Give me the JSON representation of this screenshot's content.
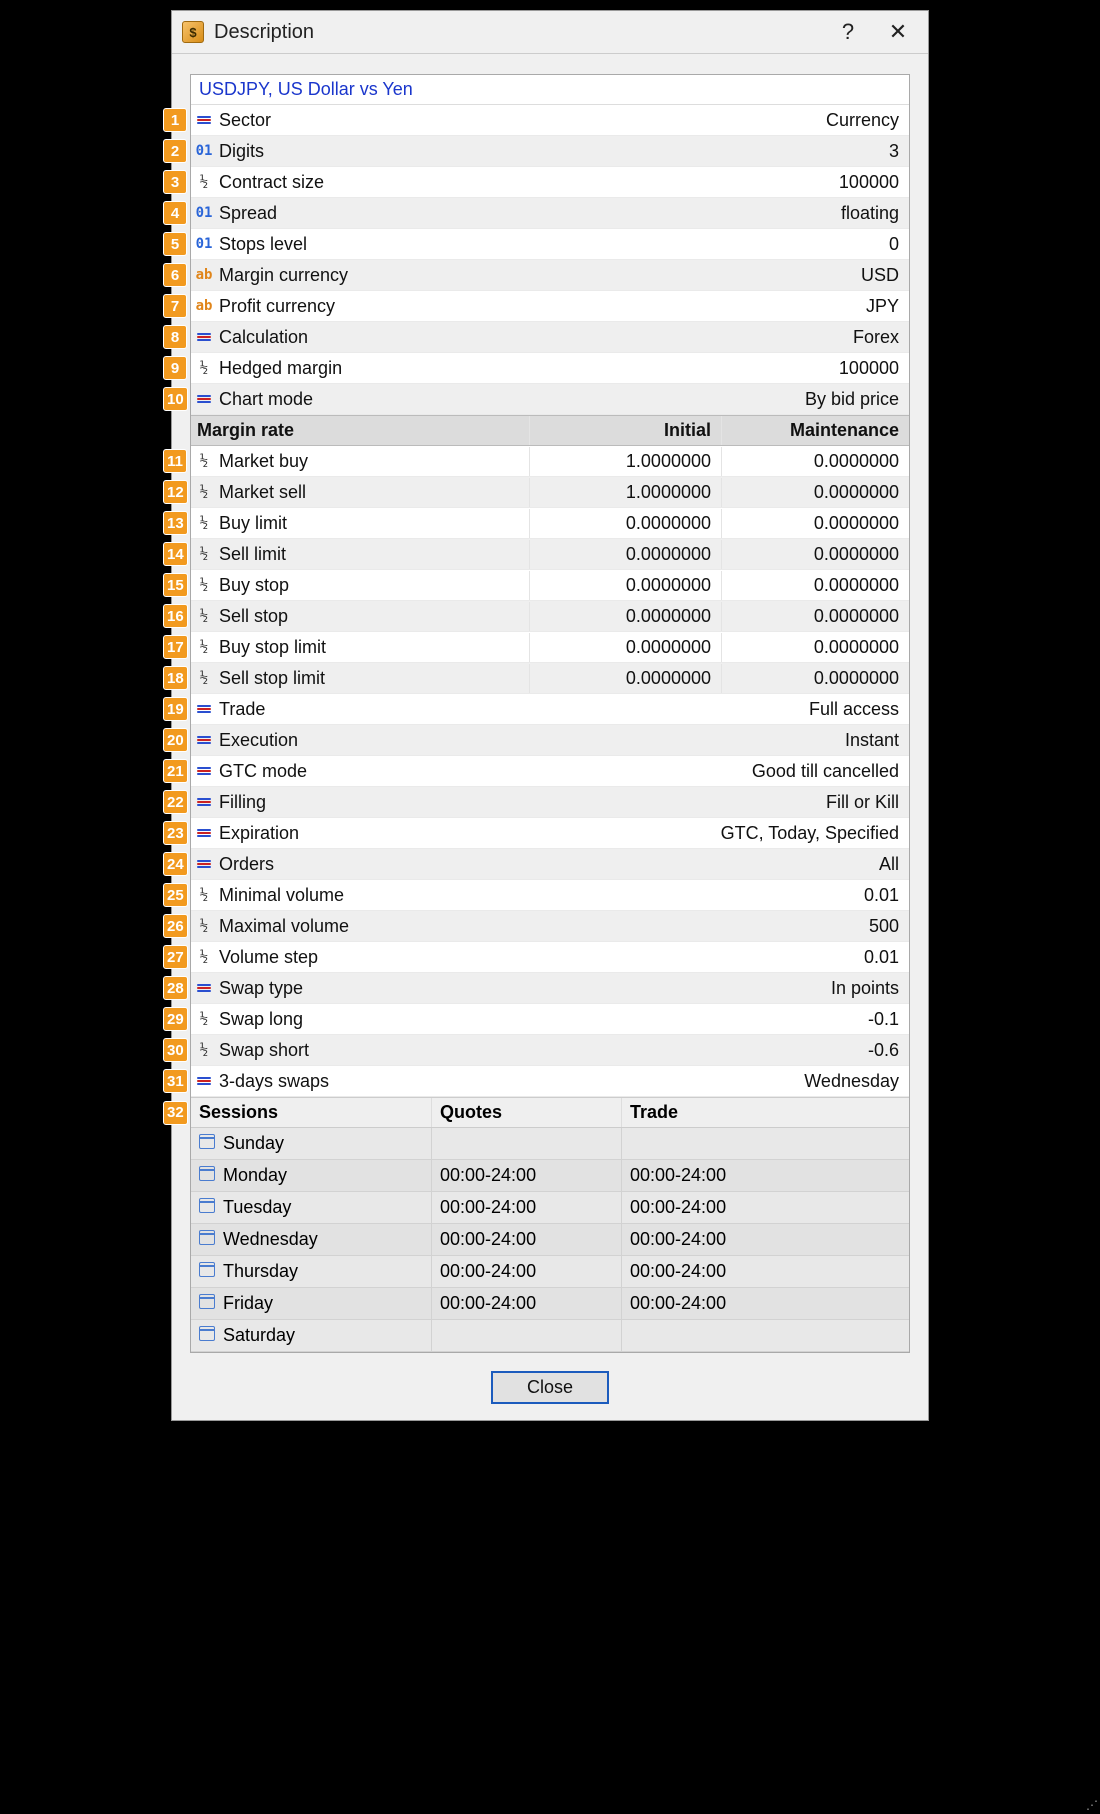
{
  "dialog": {
    "title": "Description",
    "help": "?",
    "close_symbol": "✕",
    "close_button": "Close",
    "app_icon_glyph": "$"
  },
  "symbol_header": "USDJPY, US Dollar vs Yen",
  "props": [
    {
      "n": "1",
      "icon": "enum",
      "label": "Sector",
      "value": "Currency"
    },
    {
      "n": "2",
      "icon": "01",
      "label": "Digits",
      "value": "3"
    },
    {
      "n": "3",
      "icon": "half",
      "label": "Contract size",
      "value": "100000"
    },
    {
      "n": "4",
      "icon": "01",
      "label": "Spread",
      "value": "floating"
    },
    {
      "n": "5",
      "icon": "01",
      "label": "Stops level",
      "value": "0"
    },
    {
      "n": "6",
      "icon": "ab",
      "label": "Margin currency",
      "value": "USD"
    },
    {
      "n": "7",
      "icon": "ab",
      "label": "Profit currency",
      "value": "JPY"
    },
    {
      "n": "8",
      "icon": "enum",
      "label": "Calculation",
      "value": "Forex"
    },
    {
      "n": "9",
      "icon": "half",
      "label": "Hedged margin",
      "value": "100000"
    },
    {
      "n": "10",
      "icon": "enum",
      "label": "Chart mode",
      "value": "By bid price"
    }
  ],
  "margin_header": {
    "label": "Margin rate",
    "col2": "Initial",
    "col3": "Maintenance"
  },
  "margin_rows": [
    {
      "n": "11",
      "icon": "half",
      "label": "Market buy",
      "initial": "1.0000000",
      "maint": "0.0000000"
    },
    {
      "n": "12",
      "icon": "half",
      "label": "Market sell",
      "initial": "1.0000000",
      "maint": "0.0000000"
    },
    {
      "n": "13",
      "icon": "half",
      "label": "Buy limit",
      "initial": "0.0000000",
      "maint": "0.0000000"
    },
    {
      "n": "14",
      "icon": "half",
      "label": "Sell limit",
      "initial": "0.0000000",
      "maint": "0.0000000"
    },
    {
      "n": "15",
      "icon": "half",
      "label": "Buy stop",
      "initial": "0.0000000",
      "maint": "0.0000000"
    },
    {
      "n": "16",
      "icon": "half",
      "label": "Sell stop",
      "initial": "0.0000000",
      "maint": "0.0000000"
    },
    {
      "n": "17",
      "icon": "half",
      "label": "Buy stop limit",
      "initial": "0.0000000",
      "maint": "0.0000000"
    },
    {
      "n": "18",
      "icon": "half",
      "label": "Sell stop limit",
      "initial": "0.0000000",
      "maint": "0.0000000"
    }
  ],
  "trade_props": [
    {
      "n": "19",
      "icon": "enum",
      "label": "Trade",
      "value": "Full access"
    },
    {
      "n": "20",
      "icon": "enum",
      "label": "Execution",
      "value": "Instant"
    },
    {
      "n": "21",
      "icon": "enum",
      "label": "GTC mode",
      "value": "Good till cancelled"
    },
    {
      "n": "22",
      "icon": "enum",
      "label": "Filling",
      "value": "Fill or Kill"
    },
    {
      "n": "23",
      "icon": "enum",
      "label": "Expiration",
      "value": "GTC, Today, Specified"
    },
    {
      "n": "24",
      "icon": "enum",
      "label": "Orders",
      "value": "All"
    },
    {
      "n": "25",
      "icon": "half",
      "label": "Minimal volume",
      "value": "0.01"
    },
    {
      "n": "26",
      "icon": "half",
      "label": "Maximal volume",
      "value": "500"
    },
    {
      "n": "27",
      "icon": "half",
      "label": "Volume step",
      "value": "0.01"
    },
    {
      "n": "28",
      "icon": "enum",
      "label": "Swap type",
      "value": "In points"
    },
    {
      "n": "29",
      "icon": "half",
      "label": "Swap long",
      "value": "-0.1"
    },
    {
      "n": "30",
      "icon": "half",
      "label": "Swap short",
      "value": "-0.6"
    },
    {
      "n": "31",
      "icon": "enum",
      "label": "3-days swaps",
      "value": "Wednesday"
    }
  ],
  "sessions_header": {
    "n": "32",
    "col1": "Sessions",
    "col2": "Quotes",
    "col3": "Trade"
  },
  "sessions": [
    {
      "day": "Sunday",
      "quotes": "",
      "trade": ""
    },
    {
      "day": "Monday",
      "quotes": "00:00-24:00",
      "trade": "00:00-24:00"
    },
    {
      "day": "Tuesday",
      "quotes": "00:00-24:00",
      "trade": "00:00-24:00"
    },
    {
      "day": "Wednesday",
      "quotes": "00:00-24:00",
      "trade": "00:00-24:00"
    },
    {
      "day": "Thursday",
      "quotes": "00:00-24:00",
      "trade": "00:00-24:00"
    },
    {
      "day": "Friday",
      "quotes": "00:00-24:00",
      "trade": "00:00-24:00"
    },
    {
      "day": "Saturday",
      "quotes": "",
      "trade": ""
    }
  ],
  "icon_text": {
    "01": "01",
    "half": "½",
    "ab": "ab"
  }
}
